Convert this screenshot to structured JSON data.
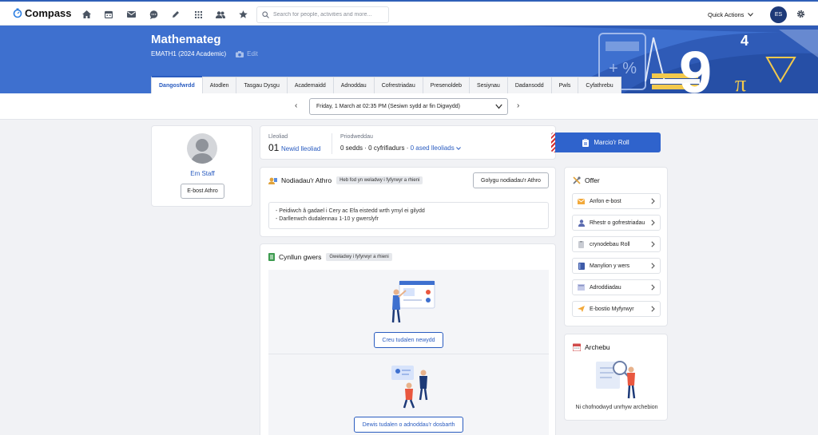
{
  "app": {
    "name": "Compass"
  },
  "nav": {
    "icons": [
      "home-icon",
      "calendar-icon",
      "mail-icon",
      "chat-icon",
      "pencil-icon",
      "grid-icon",
      "people-icon",
      "star-icon"
    ]
  },
  "search": {
    "placeholder": "Search for people, activities and more..."
  },
  "header": {
    "quick_actions": "Quick Actions",
    "user_initials": "ES"
  },
  "course": {
    "title": "Mathemateg",
    "subtitle": "EMATH1 (2024 Academic)",
    "edit_label": "Edit"
  },
  "tabs": [
    {
      "label": "Dangosfwrdd",
      "active": true
    },
    {
      "label": "Atodlen"
    },
    {
      "label": "Tasgau Dysgu"
    },
    {
      "label": "Academaidd"
    },
    {
      "label": "Adnoddau"
    },
    {
      "label": "Cofrestriadau"
    },
    {
      "label": "Presenoldeb"
    },
    {
      "label": "Sesiynau"
    },
    {
      "label": "Dadansodd"
    },
    {
      "label": "Pwls"
    },
    {
      "label": "Cyfathrebu"
    }
  ],
  "session": {
    "prev": "‹",
    "next": "›",
    "selected": "Friday, 1 March at 02:35 PM (Sesiwn sydd ar fin Digwydd)"
  },
  "staff": {
    "name": "Em Staff",
    "email_button": "E-bost Athro"
  },
  "location": {
    "label": "Lleoliad",
    "value": "01",
    "change_link": "Newid lleoliad",
    "resources_label": "Priodweddau",
    "seats": "0 sedds",
    "devices": "0 cyfrifiadurs",
    "assets": "0 ased lleoliads",
    "sep1": " · ",
    "sep2": " · "
  },
  "roll": {
    "button": "Marcio'r Roll"
  },
  "teacher_notes": {
    "title": "Nodiadau'r Athro",
    "tag": "Heb fod yn weladwy i fyfyrwyr a rhieni",
    "edit_button": "Golygu nodiadau'r Athro",
    "lines": [
      "- Peidiwch â gadael i Cery ac Efa eistedd wrth ymyl ei gilydd",
      "- Darllenwch dudalennau 1-10 y gwerslyfr"
    ]
  },
  "lesson_plan": {
    "title": "Cynllun gwers",
    "tag": "Gweladwy i fyfyrwyr a rhieni",
    "create_button": "Creu tudalen newydd",
    "choose_button": "Dewis tudalen o adnoddau'r dosbarth"
  },
  "offer": {
    "title": "Offer",
    "items": [
      {
        "label": "Anfon e-bost",
        "icon": "envelope-icon"
      },
      {
        "label": "Rhestr o gofrestriadau",
        "icon": "person-icon"
      },
      {
        "label": "crynodebau Roll",
        "icon": "clipboard-icon"
      },
      {
        "label": "Manylion y wers",
        "icon": "book-icon"
      },
      {
        "label": "Adroddiadau",
        "icon": "report-icon"
      },
      {
        "label": "E-bostio Myfyrwyr",
        "icon": "paper-plane-icon"
      }
    ]
  },
  "booking": {
    "title": "Archebu",
    "empty": "Ni chofnodwyd unrhyw archebion"
  },
  "colors": {
    "accent": "#2f63cc",
    "hero": "#3e70cf"
  }
}
